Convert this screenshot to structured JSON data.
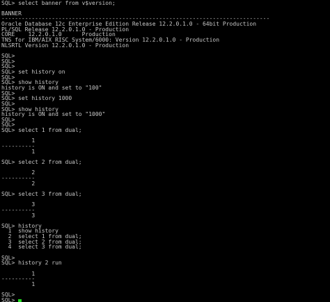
{
  "terminal": {
    "text_color": "#c8c8c8",
    "background": "#000000",
    "cursor_color": "#22dd22",
    "lines": [
      "SQL> select banner from v$version;",
      "",
      "BANNER",
      "--------------------------------------------------------------------------------",
      "Oracle Database 12c Enterprise Edition Release 12.2.0.1.0 - 64bit Production",
      "PL/SQL Release 12.2.0.1.0 - Production",
      "CORE    12.2.0.1.0      Production",
      "TNS for IBM/AIX RISC System/6000: Version 12.2.0.1.0 - Production",
      "NLSRTL Version 12.2.0.1.0 - Production",
      "",
      "SQL>",
      "SQL>",
      "SQL>",
      "SQL> set history on",
      "SQL>",
      "SQL> show history",
      "history is ON and set to \"100\"",
      "SQL>",
      "SQL> set history 1000",
      "SQL>",
      "SQL> show history",
      "history is ON and set to \"1000\"",
      "SQL>",
      "SQL>",
      "SQL> select 1 from dual;",
      "",
      "         1",
      "----------",
      "         1",
      "",
      "SQL> select 2 from dual;",
      "",
      "         2",
      "----------",
      "         2",
      "",
      "SQL> select 3 from dual;",
      "",
      "         3",
      "----------",
      "         3",
      "",
      "SQL> history",
      "  1  show history",
      "  2  select 1 from dual;",
      "  3  select 2 from dual;",
      "  4  select 3 from dual;",
      "",
      "SQL>",
      "SQL> history 2 run",
      "",
      "         1",
      "----------",
      "         1",
      "",
      "SQL>",
      "SQL>"
    ]
  }
}
